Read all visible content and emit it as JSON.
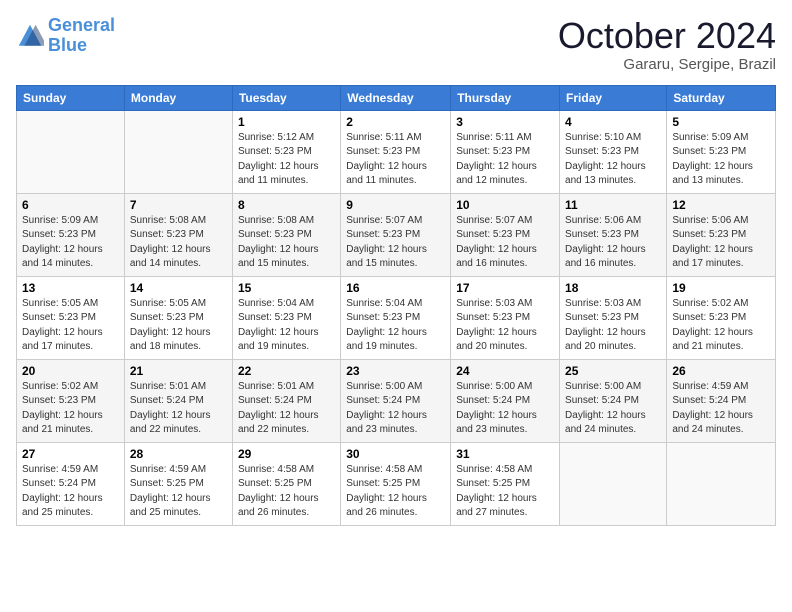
{
  "header": {
    "logo_line1": "General",
    "logo_line2": "Blue",
    "month": "October 2024",
    "location": "Gararu, Sergipe, Brazil"
  },
  "weekdays": [
    "Sunday",
    "Monday",
    "Tuesday",
    "Wednesday",
    "Thursday",
    "Friday",
    "Saturday"
  ],
  "weeks": [
    [
      {
        "day": null,
        "sunrise": null,
        "sunset": null,
        "daylight": null
      },
      {
        "day": null,
        "sunrise": null,
        "sunset": null,
        "daylight": null
      },
      {
        "day": "1",
        "sunrise": "Sunrise: 5:12 AM",
        "sunset": "Sunset: 5:23 PM",
        "daylight": "Daylight: 12 hours and 11 minutes."
      },
      {
        "day": "2",
        "sunrise": "Sunrise: 5:11 AM",
        "sunset": "Sunset: 5:23 PM",
        "daylight": "Daylight: 12 hours and 11 minutes."
      },
      {
        "day": "3",
        "sunrise": "Sunrise: 5:11 AM",
        "sunset": "Sunset: 5:23 PM",
        "daylight": "Daylight: 12 hours and 12 minutes."
      },
      {
        "day": "4",
        "sunrise": "Sunrise: 5:10 AM",
        "sunset": "Sunset: 5:23 PM",
        "daylight": "Daylight: 12 hours and 13 minutes."
      },
      {
        "day": "5",
        "sunrise": "Sunrise: 5:09 AM",
        "sunset": "Sunset: 5:23 PM",
        "daylight": "Daylight: 12 hours and 13 minutes."
      }
    ],
    [
      {
        "day": "6",
        "sunrise": "Sunrise: 5:09 AM",
        "sunset": "Sunset: 5:23 PM",
        "daylight": "Daylight: 12 hours and 14 minutes."
      },
      {
        "day": "7",
        "sunrise": "Sunrise: 5:08 AM",
        "sunset": "Sunset: 5:23 PM",
        "daylight": "Daylight: 12 hours and 14 minutes."
      },
      {
        "day": "8",
        "sunrise": "Sunrise: 5:08 AM",
        "sunset": "Sunset: 5:23 PM",
        "daylight": "Daylight: 12 hours and 15 minutes."
      },
      {
        "day": "9",
        "sunrise": "Sunrise: 5:07 AM",
        "sunset": "Sunset: 5:23 PM",
        "daylight": "Daylight: 12 hours and 15 minutes."
      },
      {
        "day": "10",
        "sunrise": "Sunrise: 5:07 AM",
        "sunset": "Sunset: 5:23 PM",
        "daylight": "Daylight: 12 hours and 16 minutes."
      },
      {
        "day": "11",
        "sunrise": "Sunrise: 5:06 AM",
        "sunset": "Sunset: 5:23 PM",
        "daylight": "Daylight: 12 hours and 16 minutes."
      },
      {
        "day": "12",
        "sunrise": "Sunrise: 5:06 AM",
        "sunset": "Sunset: 5:23 PM",
        "daylight": "Daylight: 12 hours and 17 minutes."
      }
    ],
    [
      {
        "day": "13",
        "sunrise": "Sunrise: 5:05 AM",
        "sunset": "Sunset: 5:23 PM",
        "daylight": "Daylight: 12 hours and 17 minutes."
      },
      {
        "day": "14",
        "sunrise": "Sunrise: 5:05 AM",
        "sunset": "Sunset: 5:23 PM",
        "daylight": "Daylight: 12 hours and 18 minutes."
      },
      {
        "day": "15",
        "sunrise": "Sunrise: 5:04 AM",
        "sunset": "Sunset: 5:23 PM",
        "daylight": "Daylight: 12 hours and 19 minutes."
      },
      {
        "day": "16",
        "sunrise": "Sunrise: 5:04 AM",
        "sunset": "Sunset: 5:23 PM",
        "daylight": "Daylight: 12 hours and 19 minutes."
      },
      {
        "day": "17",
        "sunrise": "Sunrise: 5:03 AM",
        "sunset": "Sunset: 5:23 PM",
        "daylight": "Daylight: 12 hours and 20 minutes."
      },
      {
        "day": "18",
        "sunrise": "Sunrise: 5:03 AM",
        "sunset": "Sunset: 5:23 PM",
        "daylight": "Daylight: 12 hours and 20 minutes."
      },
      {
        "day": "19",
        "sunrise": "Sunrise: 5:02 AM",
        "sunset": "Sunset: 5:23 PM",
        "daylight": "Daylight: 12 hours and 21 minutes."
      }
    ],
    [
      {
        "day": "20",
        "sunrise": "Sunrise: 5:02 AM",
        "sunset": "Sunset: 5:23 PM",
        "daylight": "Daylight: 12 hours and 21 minutes."
      },
      {
        "day": "21",
        "sunrise": "Sunrise: 5:01 AM",
        "sunset": "Sunset: 5:24 PM",
        "daylight": "Daylight: 12 hours and 22 minutes."
      },
      {
        "day": "22",
        "sunrise": "Sunrise: 5:01 AM",
        "sunset": "Sunset: 5:24 PM",
        "daylight": "Daylight: 12 hours and 22 minutes."
      },
      {
        "day": "23",
        "sunrise": "Sunrise: 5:00 AM",
        "sunset": "Sunset: 5:24 PM",
        "daylight": "Daylight: 12 hours and 23 minutes."
      },
      {
        "day": "24",
        "sunrise": "Sunrise: 5:00 AM",
        "sunset": "Sunset: 5:24 PM",
        "daylight": "Daylight: 12 hours and 23 minutes."
      },
      {
        "day": "25",
        "sunrise": "Sunrise: 5:00 AM",
        "sunset": "Sunset: 5:24 PM",
        "daylight": "Daylight: 12 hours and 24 minutes."
      },
      {
        "day": "26",
        "sunrise": "Sunrise: 4:59 AM",
        "sunset": "Sunset: 5:24 PM",
        "daylight": "Daylight: 12 hours and 24 minutes."
      }
    ],
    [
      {
        "day": "27",
        "sunrise": "Sunrise: 4:59 AM",
        "sunset": "Sunset: 5:24 PM",
        "daylight": "Daylight: 12 hours and 25 minutes."
      },
      {
        "day": "28",
        "sunrise": "Sunrise: 4:59 AM",
        "sunset": "Sunset: 5:25 PM",
        "daylight": "Daylight: 12 hours and 25 minutes."
      },
      {
        "day": "29",
        "sunrise": "Sunrise: 4:58 AM",
        "sunset": "Sunset: 5:25 PM",
        "daylight": "Daylight: 12 hours and 26 minutes."
      },
      {
        "day": "30",
        "sunrise": "Sunrise: 4:58 AM",
        "sunset": "Sunset: 5:25 PM",
        "daylight": "Daylight: 12 hours and 26 minutes."
      },
      {
        "day": "31",
        "sunrise": "Sunrise: 4:58 AM",
        "sunset": "Sunset: 5:25 PM",
        "daylight": "Daylight: 12 hours and 27 minutes."
      },
      {
        "day": null,
        "sunrise": null,
        "sunset": null,
        "daylight": null
      },
      {
        "day": null,
        "sunrise": null,
        "sunset": null,
        "daylight": null
      }
    ]
  ]
}
